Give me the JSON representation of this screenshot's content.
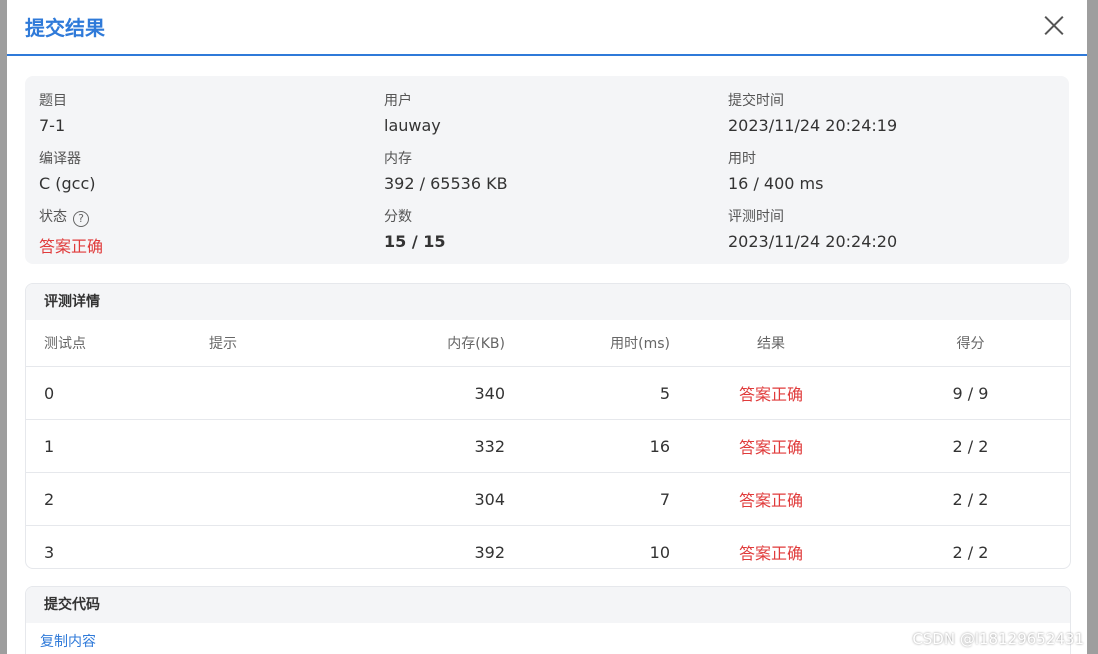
{
  "modal": {
    "title": "提交结果"
  },
  "info": {
    "problem_label": "题目",
    "problem_value": "7-1",
    "user_label": "用户",
    "user_value": "lauway",
    "submit_time_label": "提交时间",
    "submit_time_value": "2023/11/24 20:24:19",
    "compiler_label": "编译器",
    "compiler_value": "C (gcc)",
    "memory_label": "内存",
    "memory_value": "392 / 65536 KB",
    "time_label": "用时",
    "time_value": "16 / 400 ms",
    "status_label": "状态",
    "status_value": "答案正确",
    "score_label": "分数",
    "score_value": "15 / 15",
    "judge_time_label": "评测时间",
    "judge_time_value": "2023/11/24 20:24:20"
  },
  "details": {
    "title": "评测详情",
    "columns": [
      "测试点",
      "提示",
      "内存(KB)",
      "用时(ms)",
      "结果",
      "得分"
    ],
    "rows": [
      {
        "case": "0",
        "hint": "",
        "memory": "340",
        "time": "5",
        "result": "答案正确",
        "score": "9 / 9"
      },
      {
        "case": "1",
        "hint": "",
        "memory": "332",
        "time": "16",
        "result": "答案正确",
        "score": "2 / 2"
      },
      {
        "case": "2",
        "hint": "",
        "memory": "304",
        "time": "7",
        "result": "答案正确",
        "score": "2 / 2"
      },
      {
        "case": "3",
        "hint": "",
        "memory": "392",
        "time": "10",
        "result": "答案正确",
        "score": "2 / 2"
      }
    ]
  },
  "code": {
    "title": "提交代码",
    "copy_label": "复制内容"
  },
  "watermark": "CSDN @l18129652431",
  "colors": {
    "accent": "#2f7ad9",
    "success_text": "#e03b3b"
  },
  "icons": {
    "close": "close-icon",
    "help": "help-circle-icon"
  }
}
